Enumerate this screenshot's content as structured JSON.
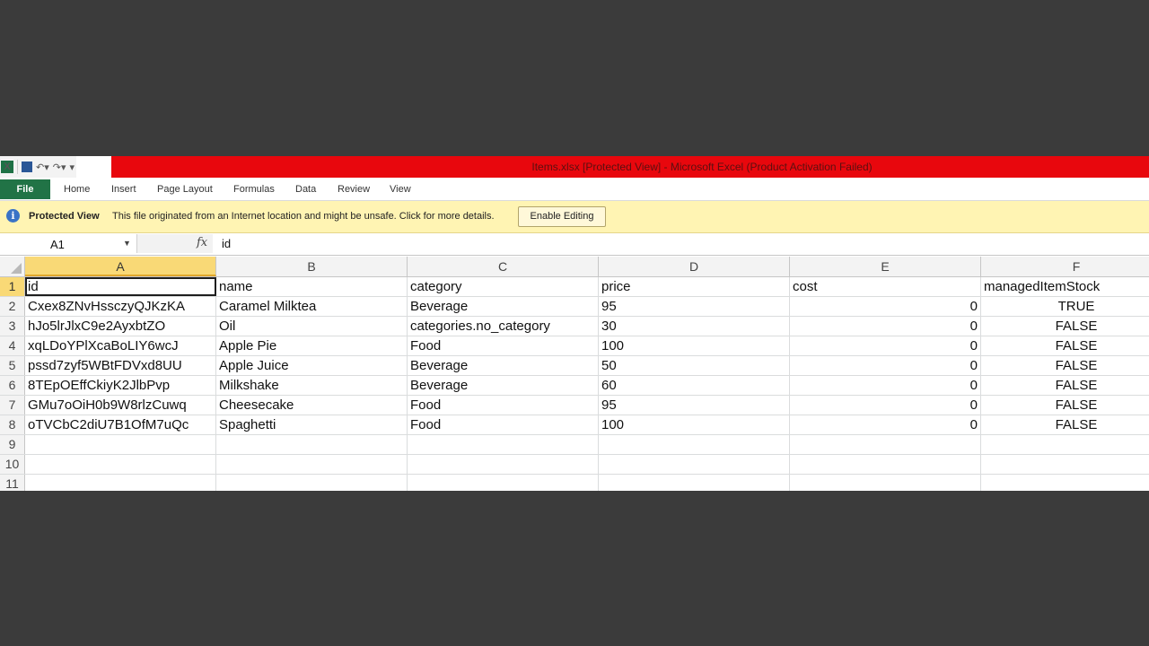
{
  "window": {
    "title": "Items.xlsx  [Protected View]  -  Microsoft Excel (Product Activation Failed)"
  },
  "qat": {
    "logo": "X",
    "undo_icon": "undo-icon",
    "redo_icon": "redo-icon"
  },
  "ribbon": {
    "file": "File",
    "tabs": [
      "Home",
      "Insert",
      "Page Layout",
      "Formulas",
      "Data",
      "Review",
      "View"
    ]
  },
  "protected_view": {
    "label": "Protected View",
    "message": "This file originated from an Internet location and might be unsafe. Click for more details.",
    "button": "Enable Editing"
  },
  "formula_bar": {
    "name_box": "A1",
    "fx": "fx",
    "content": "id"
  },
  "sheet": {
    "columns": [
      "A",
      "B",
      "C",
      "D",
      "E",
      "F"
    ],
    "row_numbers": [
      "1",
      "2",
      "3",
      "4",
      "5",
      "6",
      "7",
      "8",
      "9",
      "10",
      "11"
    ],
    "rows": [
      [
        "id",
        "name",
        "category",
        "price",
        "cost",
        "managedItemStock"
      ],
      [
        "Cxex8ZNvHssczyQJKzKA",
        "Caramel Milktea",
        "Beverage",
        "95",
        "0",
        "TRUE"
      ],
      [
        "hJo5lrJlxC9e2AyxbtZO",
        "Oil",
        "categories.no_category",
        "30",
        "0",
        "FALSE"
      ],
      [
        "xqLDoYPlXcaBoLIY6wcJ",
        "Apple Pie",
        "Food",
        "100",
        "0",
        "FALSE"
      ],
      [
        "pssd7zyf5WBtFDVxd8UU",
        "Apple Juice",
        "Beverage",
        "50",
        "0",
        "FALSE"
      ],
      [
        "8TEpOEffCkiyK2JlbPvp",
        "Milkshake",
        "Beverage",
        "60",
        "0",
        "FALSE"
      ],
      [
        "GMu7oOiH0b9W8rlzCuwq",
        "Cheesecake",
        "Food",
        "95",
        "0",
        "FALSE"
      ],
      [
        "oTVCbC2diU7B1OfM7uQc",
        "Spaghetti",
        "Food",
        "100",
        "0",
        "FALSE"
      ],
      [
        "",
        "",
        "",
        "",
        "",
        ""
      ],
      [
        "",
        "",
        "",
        "",
        "",
        ""
      ],
      [
        "",
        "",
        "",
        "",
        "",
        ""
      ]
    ],
    "selected_cell": "A1"
  }
}
